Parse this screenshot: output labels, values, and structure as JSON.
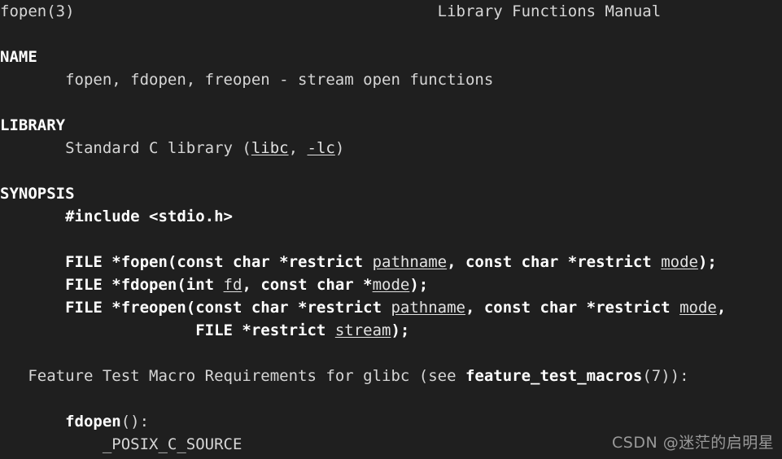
{
  "terminal": {
    "background_color": "#1f1f1f",
    "foreground_color": "#d6d6d6",
    "bold_color": "#ffffff",
    "watermark_color": "#9a9a9a"
  },
  "manpage": {
    "header": {
      "left": "fopen(3)",
      "center": "Library Functions Manual",
      "right": ""
    },
    "sections": [
      {
        "title": "NAME",
        "body": "fopen, fdopen, freopen - stream open functions"
      },
      {
        "title": "LIBRARY",
        "body": "Standard C library (libc, -lc)",
        "links": [
          "libc",
          "-lc"
        ]
      },
      {
        "title": "SYNOPSIS",
        "include": "#include <stdio.h>",
        "prototypes": [
          "FILE *fopen(const char *restrict pathname, const char *restrict mode);",
          "FILE *fdopen(int fd, const char *mode);",
          "FILE *freopen(const char *restrict pathname, const char *restrict mode,",
          "             FILE *restrict stream);"
        ],
        "feature_test_intro": "Feature Test Macro Requirements for glibc (see feature_test_macros(7)):",
        "feature_test_macro_ref": "feature_test_macros",
        "feature_test_entries": [
          {
            "func": "fdopen",
            "suffix": "():",
            "macro": "_POSIX_C_SOURCE"
          }
        ]
      }
    ]
  },
  "lines": {
    "l01_left": "fopen(3)",
    "l01_center": "Library Functions Manual",
    "l03_name": "NAME",
    "l04_funcs": "fopen, fdopen, freopen - stream open functions",
    "l06_library": "LIBRARY",
    "l07_std_pre": "Standard C library (",
    "l07_libc": "libc",
    "l07_mid": ", ",
    "l07_lc": "-lc",
    "l07_post": ")",
    "l09_synopsis": "SYNOPSIS",
    "l10_include": "#include <stdio.h>",
    "p1_a": "FILE *fopen(const char *restrict ",
    "p1_path": "pathname",
    "p1_b": ", const char *restrict ",
    "p1_mode": "mode",
    "p1_c": ");",
    "p2_a": "FILE *fdopen(int ",
    "p2_fd": "fd",
    "p2_b": ", const char *",
    "p2_mode": "mode",
    "p2_c": ");",
    "p3_a": "FILE *freopen(const char *restrict ",
    "p3_path": "pathname",
    "p3_b": ", const char *restrict ",
    "p3_mode": "mode",
    "p3_c": ",",
    "p4_a": "FILE *restrict ",
    "p4_stream": "stream",
    "p4_b": ");",
    "ft_a": "Feature Test Macro Requirements for glibc (see ",
    "ft_bold": "feature_test_macros",
    "ft_b": "(7)):",
    "fd_bold": "fdopen",
    "fd_rest": "():",
    "posix": "_POSIX_C_SOURCE"
  },
  "watermark": {
    "text": "CSDN @迷茫的启明星"
  }
}
